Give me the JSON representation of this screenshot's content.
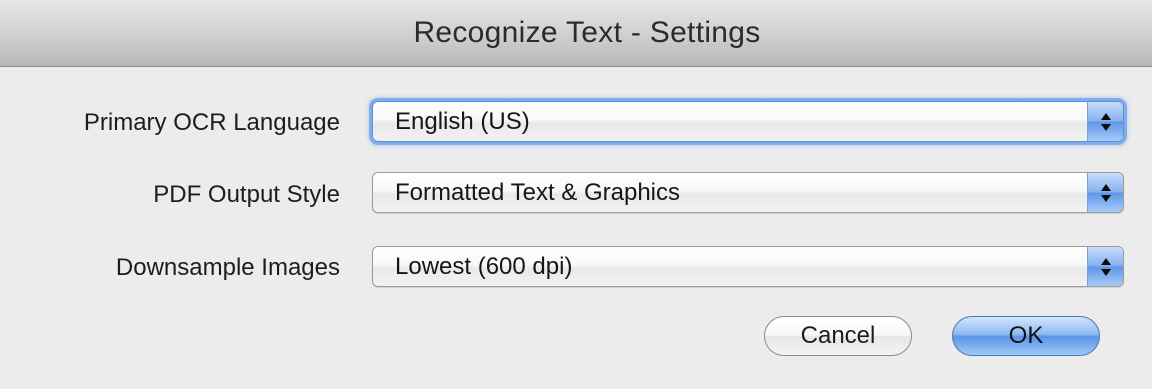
{
  "window": {
    "title": "Recognize Text - Settings"
  },
  "fields": [
    {
      "label": "Primary OCR Language",
      "value": "English (US)"
    },
    {
      "label": "PDF Output Style",
      "value": "Formatted Text & Graphics"
    },
    {
      "label": "Downsample Images",
      "value": "Lowest (600 dpi)"
    }
  ],
  "buttons": {
    "cancel_label": "Cancel",
    "ok_label": "OK"
  },
  "icons": {
    "popup_arrows": "up-down-chevron-icon"
  },
  "colors": {
    "accent": "#5f97e8",
    "focus_ring": "#68a0e9"
  }
}
